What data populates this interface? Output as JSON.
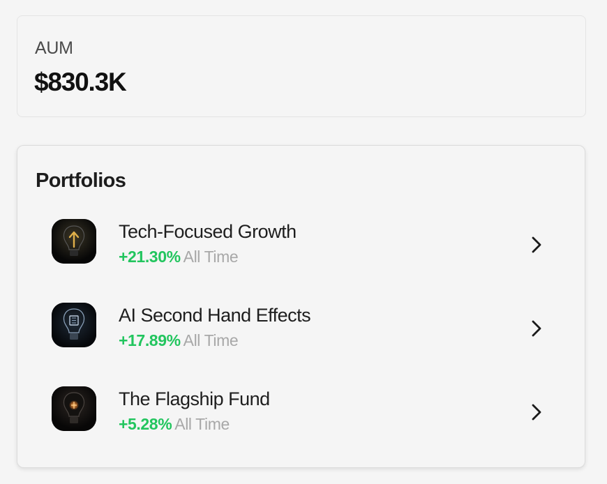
{
  "aum": {
    "label": "AUM",
    "value": "$830.3K"
  },
  "portfolios": {
    "title": "Portfolios",
    "items": [
      {
        "name": "Tech-Focused Growth",
        "change": "+21.30%",
        "period": "All Time",
        "thumb_icon": "lightbulb-arrow-icon",
        "accent": "#e0b04a"
      },
      {
        "name": "AI Second Hand Effects",
        "change": "+17.89%",
        "period": "All Time",
        "thumb_icon": "lightbulb-chip-icon",
        "accent": "#8aa0b8"
      },
      {
        "name": "The Flagship Fund",
        "change": "+5.28%",
        "period": "All Time",
        "thumb_icon": "lightbulb-glow-icon",
        "accent": "#e07a2a"
      }
    ]
  },
  "colors": {
    "positive": "#22c55e",
    "muted": "#a8a8a8",
    "background": "#f5f5f5"
  }
}
